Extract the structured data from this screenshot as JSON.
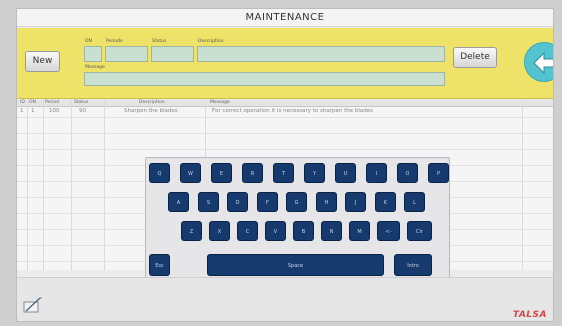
{
  "window": {
    "title": "MAINTENANCE"
  },
  "form": {
    "new_label": "New",
    "delete_label": "Delete",
    "fields": {
      "on": "ON",
      "periode": "Periode",
      "status": "Status",
      "description": "Description",
      "message": "Message"
    }
  },
  "table": {
    "headers": [
      "ID",
      "ON",
      "Period",
      "Status",
      "Description",
      "Message"
    ],
    "rows": [
      [
        "1",
        "1",
        "100",
        "90",
        "Sharpen the blades",
        "For correct operation it is necessary to sharpen the blades"
      ]
    ]
  },
  "keyboard": {
    "row1": [
      "Q",
      "W",
      "E",
      "R",
      "T",
      "Y",
      "U",
      "I",
      "O",
      "P"
    ],
    "row2": [
      "A",
      "S",
      "D",
      "F",
      "G",
      "H",
      "J",
      "K",
      "L"
    ],
    "row3": [
      "Z",
      "X",
      "C",
      "V",
      "B",
      "N",
      "M",
      "<-",
      "Clr"
    ],
    "esc": "Esc",
    "space": "Space",
    "enter": "Intro"
  },
  "footer": {
    "brand": "TALSA"
  },
  "colors": {
    "accent_yellow": "#efe269",
    "back_button": "#53c3cf",
    "key_blue": "#163a6e",
    "brand_red": "#d64545"
  },
  "icons": {
    "back": "arrow-left-icon",
    "note": "notepad-pen-icon"
  }
}
